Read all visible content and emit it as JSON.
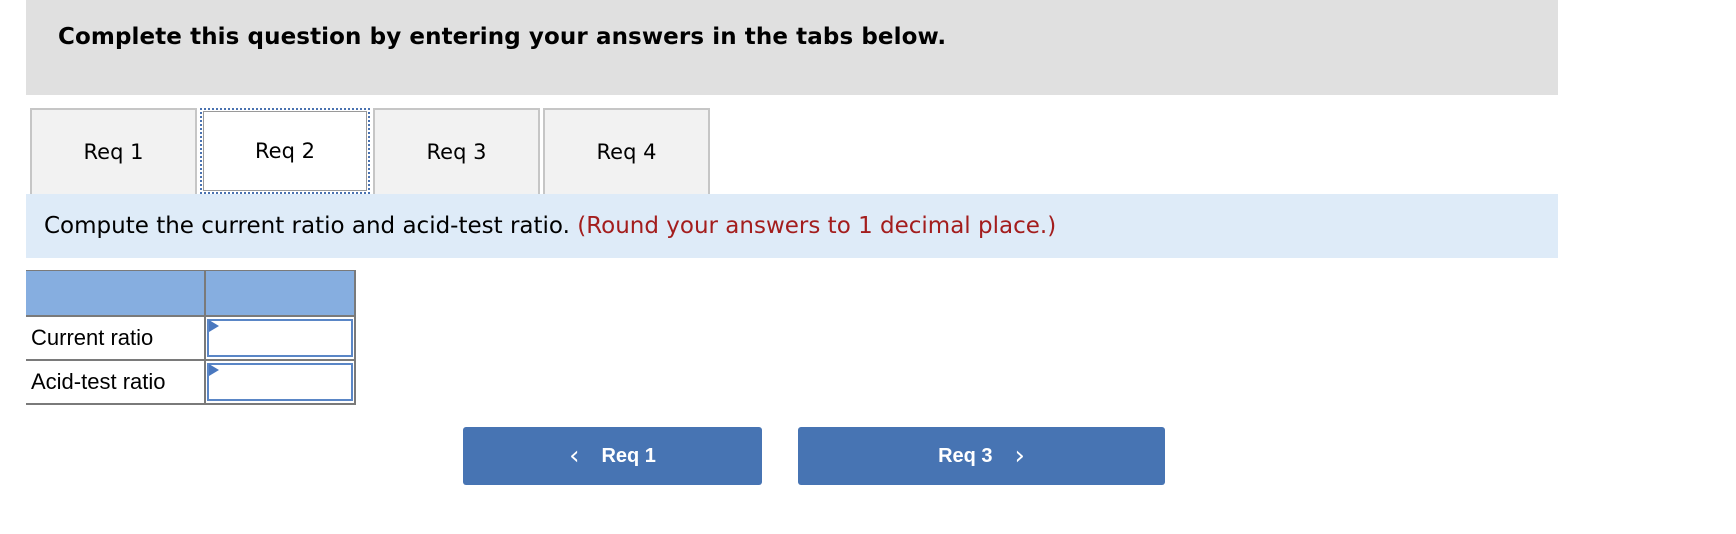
{
  "header": {
    "title": "Complete this question by entering your answers in the tabs below."
  },
  "tabs": [
    {
      "label": "Req 1",
      "active": false
    },
    {
      "label": "Req 2",
      "active": true
    },
    {
      "label": "Req 3",
      "active": false
    },
    {
      "label": "Req 4",
      "active": false
    }
  ],
  "instruction": {
    "text": "Compute the current ratio and acid-test ratio.",
    "note": "(Round your answers to 1 decimal place.)",
    "note_color": "#a31d1d"
  },
  "table": {
    "header": [
      "",
      ""
    ],
    "rows": [
      {
        "label": "Current ratio",
        "value": "",
        "placeholder": ""
      },
      {
        "label": "Acid-test ratio",
        "value": "",
        "placeholder": ""
      }
    ]
  },
  "navigation": {
    "prev": {
      "label": "Req 1",
      "icon": "chevron-left-icon",
      "glyph": "‹"
    },
    "next": {
      "label": "Req 3",
      "icon": "chevron-right-icon",
      "glyph": "›"
    }
  },
  "colors": {
    "header_bg": "#e0e0e0",
    "instruction_bg": "#deebf8",
    "table_header_bg": "#86aee0",
    "button_bg": "#4774b3",
    "active_tab_focus": "#4a72b0"
  }
}
